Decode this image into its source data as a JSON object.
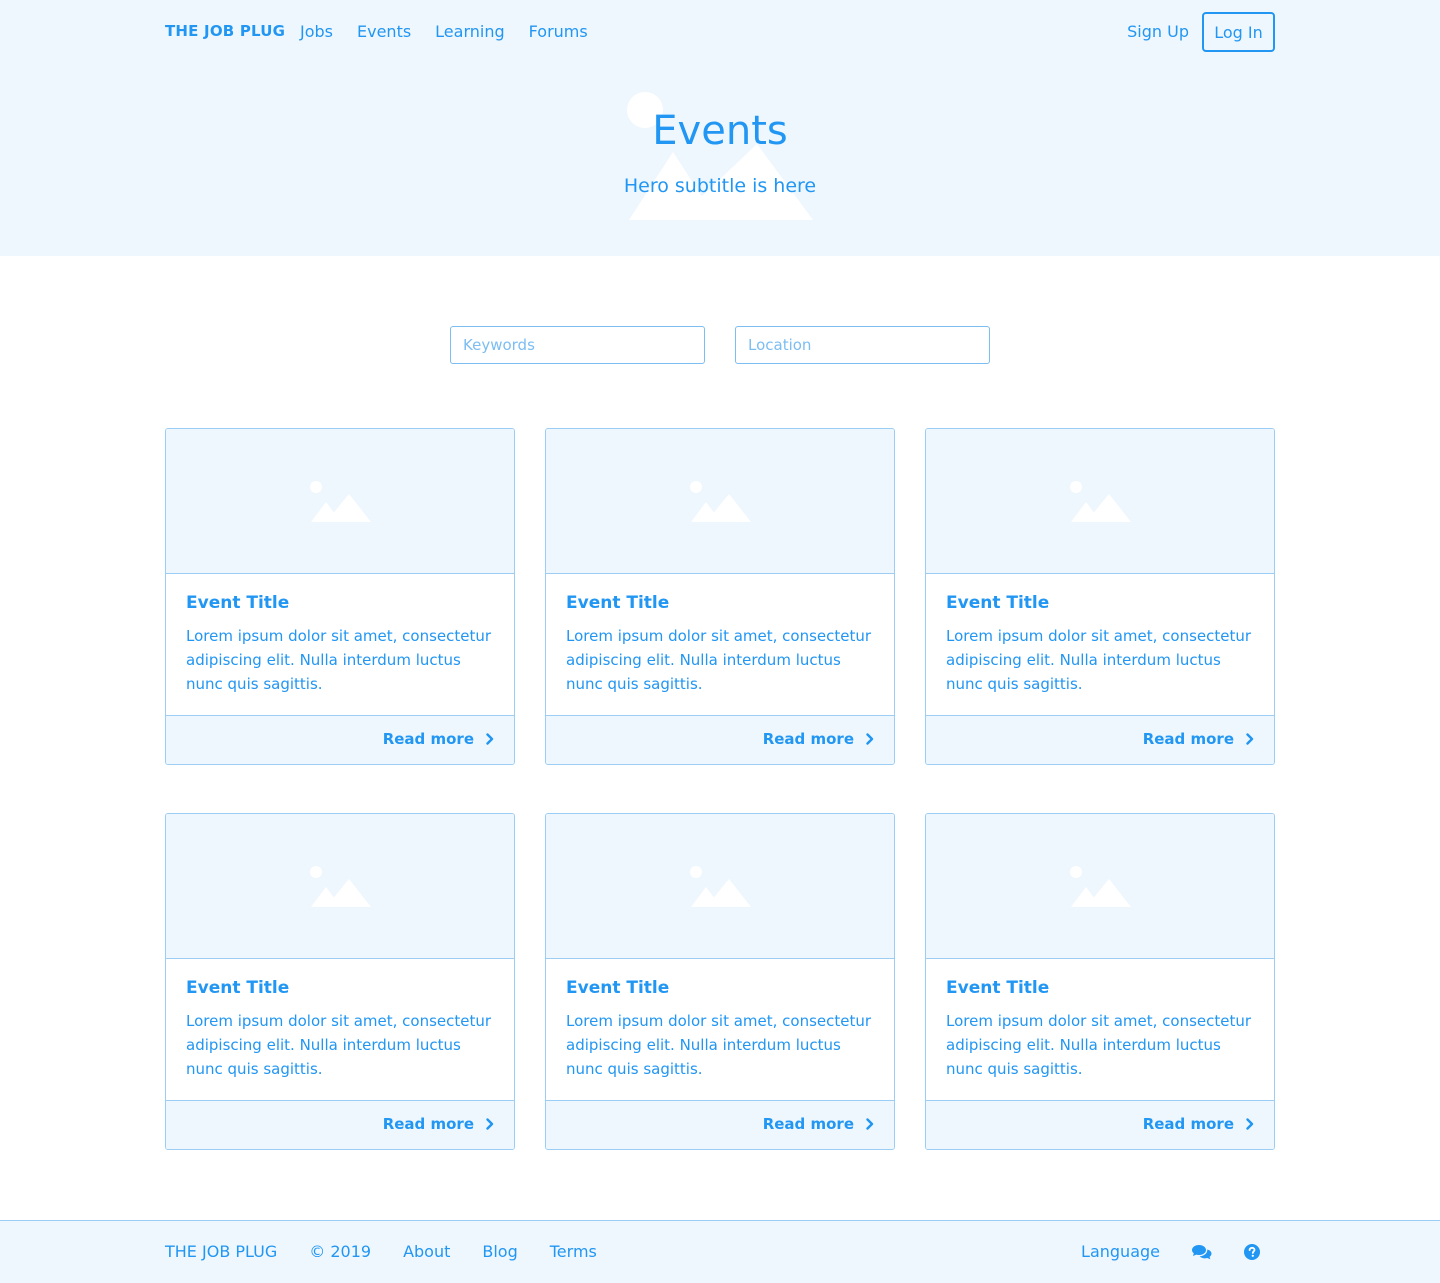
{
  "header": {
    "brand": "THE JOB PLUG",
    "nav": [
      "Jobs",
      "Events",
      "Learning",
      "Forums"
    ],
    "signup_label": "Sign Up",
    "login_label": "Log In"
  },
  "hero": {
    "title": "Events",
    "subtitle": "Hero subtitle is here"
  },
  "search": {
    "keywords_placeholder": "Keywords",
    "location_placeholder": "Location"
  },
  "cards": [
    {
      "title": "Event Title",
      "text": "Lorem ipsum dolor sit amet, consectetur adipiscing elit. Nulla interdum luctus nunc quis sagittis.",
      "link": "Read more"
    },
    {
      "title": "Event Title",
      "text": "Lorem ipsum dolor sit amet, consectetur adipiscing elit. Nulla interdum luctus nunc quis sagittis.",
      "link": "Read more"
    },
    {
      "title": "Event Title",
      "text": "Lorem ipsum dolor sit amet, consectetur adipiscing elit. Nulla interdum luctus nunc quis sagittis.",
      "link": "Read more"
    },
    {
      "title": "Event Title",
      "text": "Lorem ipsum dolor sit amet, consectetur adipiscing elit. Nulla interdum luctus nunc quis sagittis.",
      "link": "Read more"
    },
    {
      "title": "Event Title",
      "text": "Lorem ipsum dolor sit amet, consectetur adipiscing elit. Nulla interdum luctus nunc quis sagittis.",
      "link": "Read more"
    },
    {
      "title": "Event Title",
      "text": "Lorem ipsum dolor sit amet, consectetur adipiscing elit. Nulla interdum luctus nunc quis sagittis.",
      "link": "Read more"
    }
  ],
  "footer": {
    "brand": "THE JOB PLUG",
    "copyright": "© 2019",
    "links": [
      "About",
      "Blog",
      "Terms"
    ],
    "language_label": "Language",
    "icons": [
      "chat-icon",
      "help-icon"
    ]
  },
  "colors": {
    "accent": "#2196f3",
    "light_bg": "#eff7fe",
    "border": "#9ccdf5"
  }
}
